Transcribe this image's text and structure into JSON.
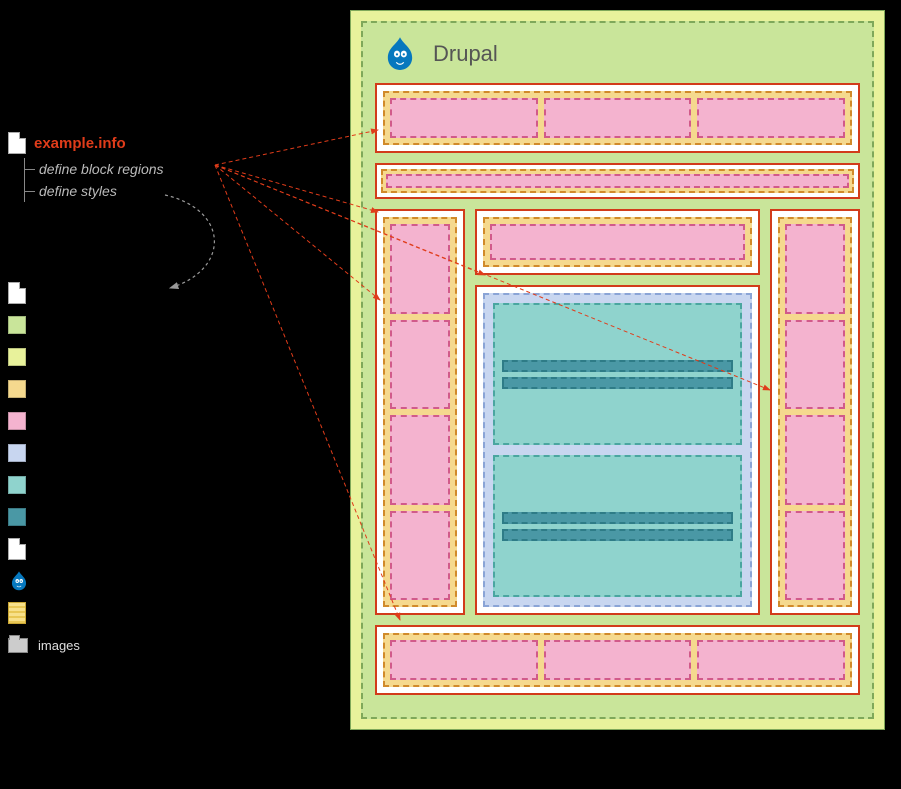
{
  "files": {
    "info_file": "example.info",
    "tree": {
      "regions": "define block regions",
      "styles": "define styles"
    }
  },
  "legend": {
    "images_label": "images"
  },
  "diagram": {
    "title": "Drupal"
  },
  "colors": {
    "green_outer": "#e8f29b",
    "green_inner": "#c9e59a",
    "orange": "#f5d98e",
    "pink": "#f4b3cf",
    "blue": "#c8d6f0",
    "teal": "#8fd3cd",
    "darkteal": "#4a98a5",
    "red_border": "#d23b1a",
    "info_red": "#e03c1a"
  }
}
